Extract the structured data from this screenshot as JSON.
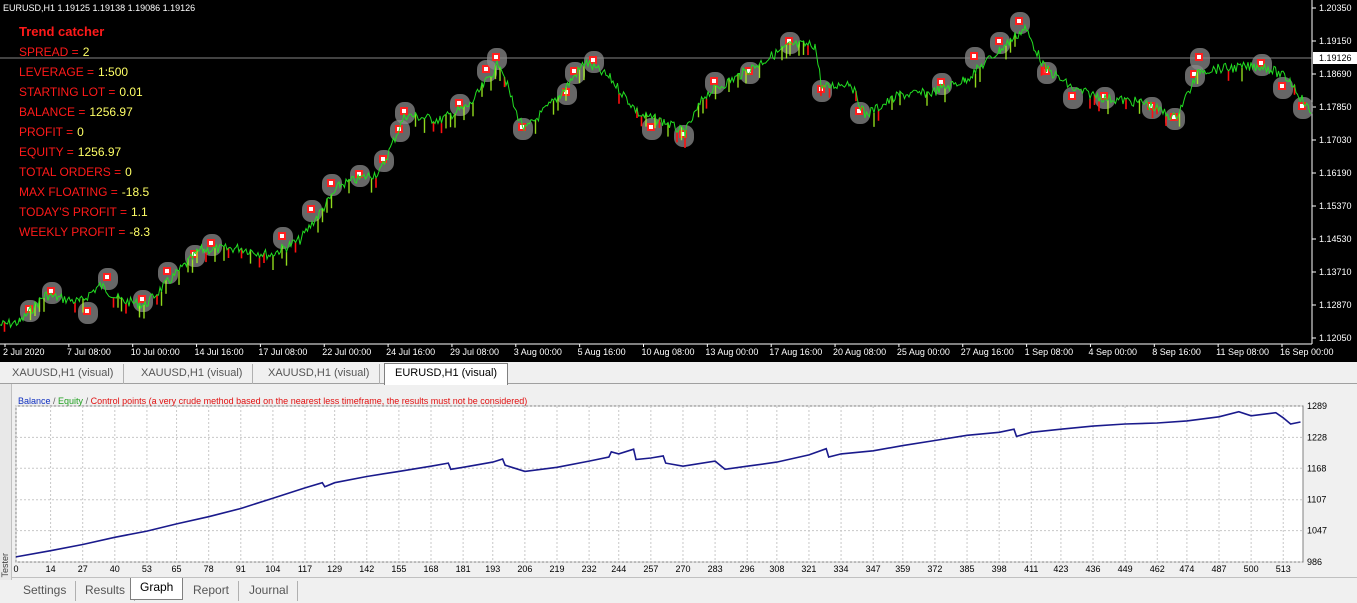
{
  "chart_header": "EURUSD,H1  1.19125 1.19138 1.19086 1.19126",
  "info": {
    "title": "Trend catcher",
    "rows": [
      {
        "label": "SPREAD =",
        "value": "2"
      },
      {
        "label": "LEVERAGE =",
        "value": "1:500"
      },
      {
        "label": "STARTING LOT =",
        "value": "0.01"
      },
      {
        "label": "BALANCE =",
        "value": "1256.97"
      },
      {
        "label": "PROFIT =",
        "value": "0"
      },
      {
        "label": "EQUITY =",
        "value": "1256.97"
      },
      {
        "label": "TOTAL ORDERS =",
        "value": "0"
      },
      {
        "label": "MAX FLOATING =",
        "value": "-18.5"
      },
      {
        "label": "TODAY'S PROFIT =",
        "value": "1.1"
      },
      {
        "label": "WEEKLY PROFIT =",
        "value": "-8.3"
      }
    ]
  },
  "price_axis": {
    "labels": [
      "1.20350",
      "1.19150",
      "1.18690",
      "1.17850",
      "1.17030",
      "1.16190",
      "1.15370",
      "1.14530",
      "1.13710",
      "1.12870",
      "1.12050"
    ],
    "current_price": "1.19126"
  },
  "time_axis": [
    "2 Jul 2020",
    "7 Jul 08:00",
    "10 Jul 00:00",
    "14 Jul 16:00",
    "17 Jul 08:00",
    "22 Jul 00:00",
    "24 Jul 16:00",
    "29 Jul 08:00",
    "3 Aug 00:00",
    "5 Aug 16:00",
    "10 Aug 08:00",
    "13 Aug 00:00",
    "17 Aug 16:00",
    "20 Aug 08:00",
    "25 Aug 00:00",
    "27 Aug 16:00",
    "1 Sep 08:00",
    "4 Sep 00:00",
    "8 Sep 16:00",
    "11 Sep 08:00",
    "16 Sep 00:00"
  ],
  "chart_tabs": [
    {
      "label": "XAUUSD,H1 (visual)",
      "active": false
    },
    {
      "label": "XAUUSD,H1 (visual)",
      "active": false
    },
    {
      "label": "XAUUSD,H1 (visual)",
      "active": false
    },
    {
      "label": "EURUSD,H1 (visual)",
      "active": true
    }
  ],
  "legend": {
    "balance": "Balance",
    "sep": " / ",
    "equity": "Equity",
    "control": "Control points (a very crude method based on the nearest less timeframe, the results must not be considered)"
  },
  "colors": {
    "balance": "#1a1a8c",
    "equity_marker": "#20a020",
    "price_green": "#22dd22",
    "price_lime": "#aaff22",
    "loss_red": "#ff1010",
    "grid": "#c8c8c8"
  },
  "chart_data": {
    "type": "line",
    "xlabel": "",
    "ylabel": "",
    "y_ticks": [
      1289,
      1228,
      1168,
      1107,
      1047,
      986
    ],
    "ylim": [
      986,
      1289
    ],
    "x_ticks": [
      0,
      14,
      27,
      40,
      53,
      65,
      78,
      91,
      104,
      117,
      129,
      142,
      155,
      168,
      181,
      193,
      206,
      219,
      232,
      244,
      257,
      270,
      283,
      296,
      308,
      321,
      334,
      347,
      359,
      372,
      385,
      398,
      411,
      423,
      436,
      449,
      462,
      474,
      487,
      500,
      513
    ],
    "series": [
      {
        "name": "Balance",
        "x": [
          0,
          14,
          27,
          40,
          53,
          65,
          78,
          91,
          104,
          117,
          124,
          125,
          129,
          142,
          155,
          168,
          175,
          176,
          181,
          193,
          197,
          198,
          206,
          219,
          232,
          240,
          241,
          244,
          250,
          251,
          257,
          262,
          263,
          270,
          283,
          287,
          296,
          308,
          321,
          328,
          329,
          334,
          347,
          359,
          372,
          385,
          398,
          404,
          405,
          411,
          423,
          436,
          449,
          462,
          474,
          487,
          495,
          500,
          510,
          513,
          516,
          520
        ],
        "values": [
          996,
          1008,
          1020,
          1034,
          1046,
          1060,
          1074,
          1090,
          1110,
          1130,
          1140,
          1132,
          1140,
          1152,
          1162,
          1172,
          1178,
          1166,
          1170,
          1180,
          1186,
          1174,
          1162,
          1170,
          1182,
          1190,
          1200,
          1196,
          1205,
          1185,
          1188,
          1192,
          1178,
          1172,
          1182,
          1166,
          1172,
          1180,
          1194,
          1206,
          1190,
          1196,
          1202,
          1212,
          1222,
          1232,
          1238,
          1244,
          1230,
          1238,
          1244,
          1250,
          1254,
          1256,
          1260,
          1268,
          1278,
          1270,
          1276,
          1266,
          1254,
          1258
        ]
      }
    ]
  },
  "bottom_tabs": [
    {
      "label": "Settings",
      "active": false
    },
    {
      "label": "Results",
      "active": false
    },
    {
      "label": "Graph",
      "active": true
    },
    {
      "label": "Report",
      "active": false
    },
    {
      "label": "Journal",
      "active": false
    }
  ],
  "side_label": "Tester"
}
